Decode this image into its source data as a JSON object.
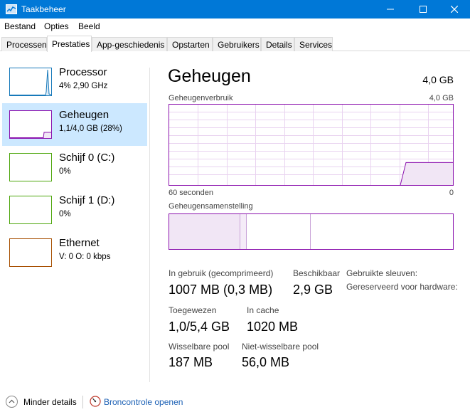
{
  "window": {
    "title": "Taakbeheer",
    "icon": "task-manager-icon"
  },
  "menu": [
    "Bestand",
    "Opties",
    "Beeld"
  ],
  "tabs": [
    {
      "label": "Processen",
      "active": false
    },
    {
      "label": "Prestaties",
      "active": true
    },
    {
      "label": "App-geschiedenis",
      "active": false
    },
    {
      "label": "Opstarten",
      "active": false
    },
    {
      "label": "Gebruikers",
      "active": false
    },
    {
      "label": "Details",
      "active": false
    },
    {
      "label": "Services",
      "active": false
    }
  ],
  "sidebar": {
    "items": [
      {
        "name": "Processor",
        "sub": "4%  2,90 GHz",
        "color": "#1779ba",
        "selected": false
      },
      {
        "name": "Geheugen",
        "sub": "1,1/4,0 GB (28%)",
        "color": "#8b12ae",
        "selected": true
      },
      {
        "name": "Schijf 0 (C:)",
        "sub": "0%",
        "color": "#4da60c",
        "selected": false
      },
      {
        "name": "Schijf 1 (D:)",
        "sub": "0%",
        "color": "#4da60c",
        "selected": false
      },
      {
        "name": "Ethernet",
        "sub": "V: 0  O: 0 kbps",
        "color": "#a74f01",
        "selected": false
      }
    ]
  },
  "main": {
    "title": "Geheugen",
    "total": "4,0 GB",
    "usage_label": "Geheugenverbruik",
    "usage_max": "4,0 GB",
    "time_left": "60 seconden",
    "time_right": "0",
    "composition_label": "Geheugensamenstelling",
    "usage_fraction": 0.28,
    "stats": {
      "in_use_label": "In gebruik (gecomprimeerd)",
      "in_use_value": "1007 MB (0,3 MB)",
      "available_label": "Beschikbaar",
      "available_value": "2,9 GB",
      "slots_label": "Gebruikte sleuven:",
      "reserved_label": "Gereserveerd voor hardware:",
      "committed_label": "Toegewezen",
      "committed_value": "1,0/5,4 GB",
      "cached_label": "In cache",
      "cached_value": "1020 MB",
      "paged_label": "Wisselbare pool",
      "paged_value": "187 MB",
      "nonpaged_label": "Niet-wisselbare pool",
      "nonpaged_value": "56,0 MB"
    }
  },
  "footer": {
    "less_details": "Minder details",
    "resource_monitor": "Broncontrole openen"
  },
  "colors": {
    "accent": "#0078d7",
    "memory": "#8b12ae",
    "selection": "#cce8ff"
  }
}
